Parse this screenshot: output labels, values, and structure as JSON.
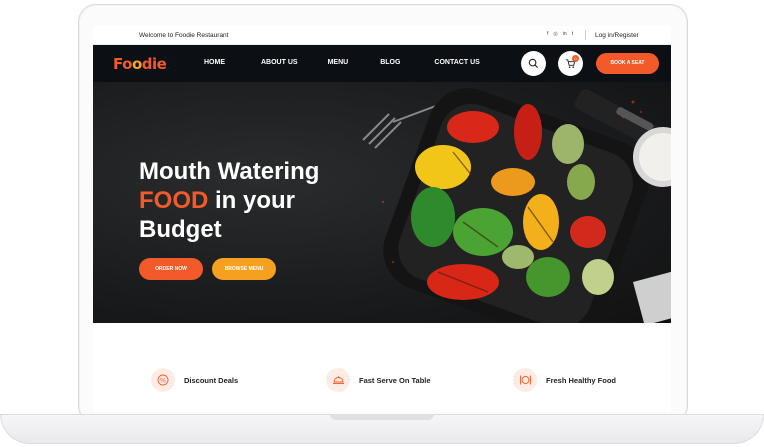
{
  "topbar": {
    "welcome": "Welcome to Foodie Restaurant",
    "socials": [
      "f",
      "◎",
      "in",
      "t"
    ],
    "login": "Log in/Register"
  },
  "nav": {
    "logo_pre": "Fo",
    "logo_mid": "o",
    "logo_post": "die",
    "items": [
      "HOME",
      "ABOUT US",
      "MENU",
      "BLOG",
      "CONTACT US"
    ],
    "cart_count": "0",
    "book_label": "BOOK A SEAT"
  },
  "hero": {
    "line1": "Mouth Watering",
    "line2_accent": "FOOD",
    "line2_rest": " in your",
    "line3": "Budget",
    "order_label": "ORDER NOW",
    "menu_label": "BROWSE MENU"
  },
  "features": [
    {
      "label": "Discount Deals",
      "icon": "discount-icon"
    },
    {
      "label": "Fast Serve On Table",
      "icon": "cloche-icon"
    },
    {
      "label": "Fresh Healthy Food",
      "icon": "plate-cutlery-icon"
    }
  ],
  "colors": {
    "accent": "#f25a2a",
    "secondary": "#f5a01e",
    "nav_bg": "#0c0f14"
  }
}
